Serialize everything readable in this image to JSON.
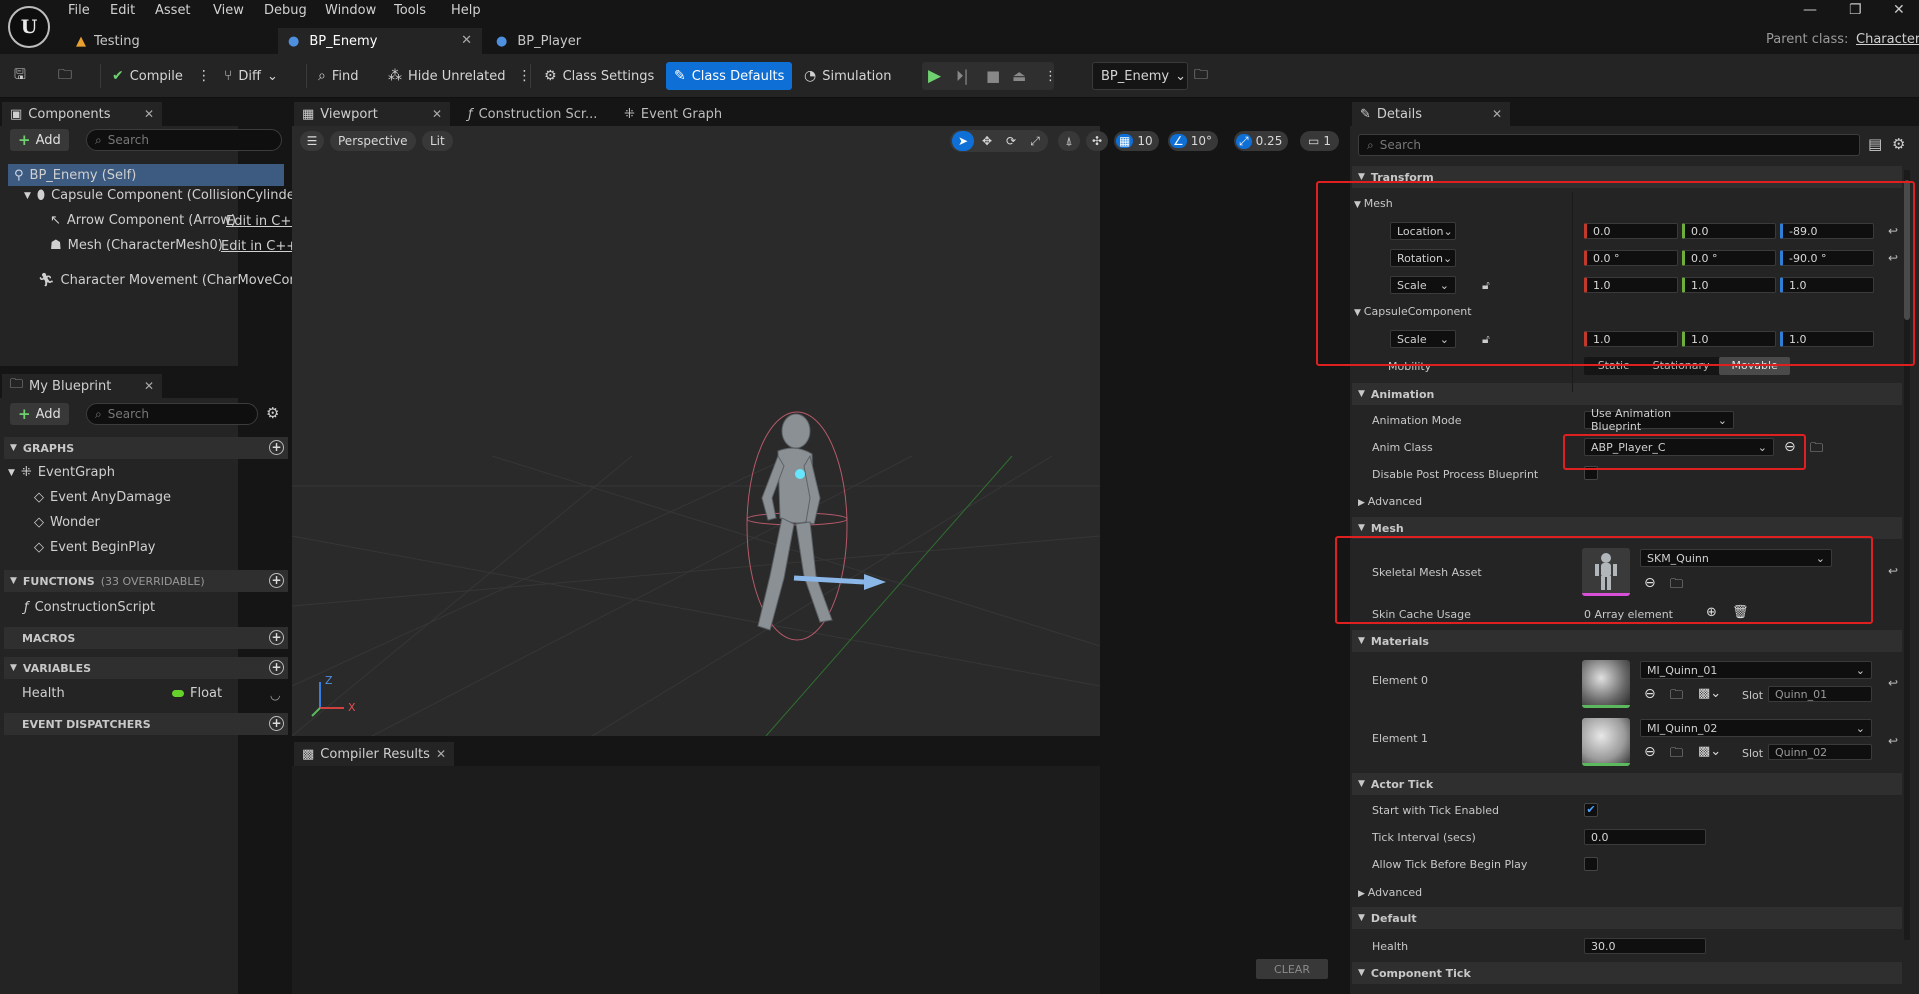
{
  "menus": [
    "File",
    "Edit",
    "Asset",
    "View",
    "Debug",
    "Window",
    "Tools",
    "Help"
  ],
  "doc_tabs": [
    "Testing",
    "BP_Enemy",
    "BP_Player"
  ],
  "parent_class": {
    "label": "Parent class:",
    "value": "Character"
  },
  "toolbar": {
    "compile": "Compile",
    "diff": "Diff",
    "find": "Find",
    "hide_unrelated": "Hide Unrelated",
    "class_settings": "Class Settings",
    "class_defaults": "Class Defaults",
    "simulation": "Simulation",
    "debug_object": "BP_Enemy"
  },
  "components": {
    "tab": "Components",
    "add": "Add",
    "search_placeholder": "Search",
    "items": [
      "BP_Enemy (Self)",
      "Capsule Component (CollisionCylinder)",
      "Arrow Component (Arrow)",
      "Mesh (CharacterMesh0)",
      "Character Movement (CharMoveComp)"
    ],
    "edit_cpp": "Edit in C++"
  },
  "my_blueprint": {
    "tab": "My Blueprint",
    "add": "Add",
    "search_placeholder": "Search",
    "graphs": "GRAPHS",
    "event_graph": "EventGraph",
    "events": [
      "Event AnyDamage",
      "Wonder",
      "Event BeginPlay"
    ],
    "functions": "FUNCTIONS",
    "functions_note": "(33 OVERRIDABLE)",
    "construction_script": "ConstructionScript",
    "macros": "MACROS",
    "variables": "VARIABLES",
    "var_name": "Health",
    "var_type": "Float",
    "dispatchers": "EVENT DISPATCHERS"
  },
  "center_tabs": [
    "Viewport",
    "Construction Scr...",
    "Event Graph"
  ],
  "viewport": {
    "perspective": "Perspective",
    "lit": "Lit",
    "grid": "10",
    "angle": "10°",
    "scale": "0.25",
    "camera": "1",
    "axis_z": "Z",
    "axis_x": "X"
  },
  "compiler": {
    "tab": "Compiler Results",
    "clear": "CLEAR"
  },
  "details": {
    "tab": "Details",
    "search_placeholder": "Search",
    "transform": "Transform",
    "mesh_sub": "Mesh",
    "location": "Location",
    "rotation": "Rotation",
    "scale": "Scale",
    "loc": [
      "0.0",
      "0.0",
      "-89.0"
    ],
    "rot": [
      "0.0 °",
      "0.0 °",
      "-90.0 °"
    ],
    "scl": [
      "1.0",
      "1.0",
      "1.0"
    ],
    "capsule": "CapsuleComponent",
    "cap_scale": [
      "1.0",
      "1.0",
      "1.0"
    ],
    "mobility": "Mobility",
    "mobility_opts": [
      "Static",
      "Stationary",
      "Movable"
    ],
    "animation": "Animation",
    "anim_mode_label": "Animation Mode",
    "anim_mode": "Use Animation Blueprint",
    "anim_class_label": "Anim Class",
    "anim_class": "ABP_Player_C",
    "disable_pp": "Disable Post Process Blueprint",
    "advanced": "Advanced",
    "mesh": "Mesh",
    "skel_label": "Skeletal Mesh Asset",
    "skel_value": "SKM_Quinn",
    "skin_cache": "Skin Cache Usage",
    "skin_cache_value": "0 Array element",
    "materials": "Materials",
    "el0": "Element 0",
    "el0_mat": "MI_Quinn_01",
    "el0_slot": "Quinn_01",
    "el1": "Element 1",
    "el1_mat": "MI_Quinn_02",
    "el1_slot": "Quinn_02",
    "slot": "Slot",
    "actor_tick": "Actor Tick",
    "start_tick": "Start with Tick Enabled",
    "tick_interval": "Tick Interval (secs)",
    "tick_interval_value": "0.0",
    "allow_tick": "Allow Tick Before Begin Play",
    "advanced2": "Advanced",
    "default": "Default",
    "health": "Health",
    "health_value": "30.0",
    "component_tick": "Component Tick"
  }
}
